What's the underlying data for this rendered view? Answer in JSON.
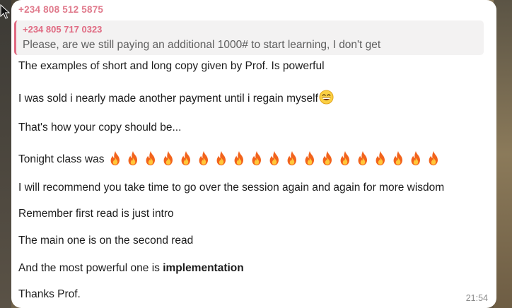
{
  "message": {
    "sender": "+234 808 512 5875",
    "reply": {
      "sender": "+234 805 717 0323",
      "text": "Please, are we still paying an additional 1000# to start learning, I don't get"
    },
    "lines": [
      "The examples of short and long copy given by Prof. Is powerful",
      "I was sold i nearly made another payment until i regain myself",
      "That's how your copy should be...",
      "Tonight class was",
      "I will recommend you take time to go over the session again and again for more wisdom",
      "Remember first read is just intro",
      "The main one is on the second read",
      "And the most powerful one is ",
      "Thanks Prof."
    ],
    "bold_word": "implementation",
    "fire_count": 19,
    "emoji": "grinning-face-with-smiling-eyes",
    "time": "21:54"
  },
  "colors": {
    "sender": "#e07a8c",
    "reply_accent": "#e06a82",
    "bubble": "#ffffff",
    "reply_bg": "#f3f2f2"
  }
}
